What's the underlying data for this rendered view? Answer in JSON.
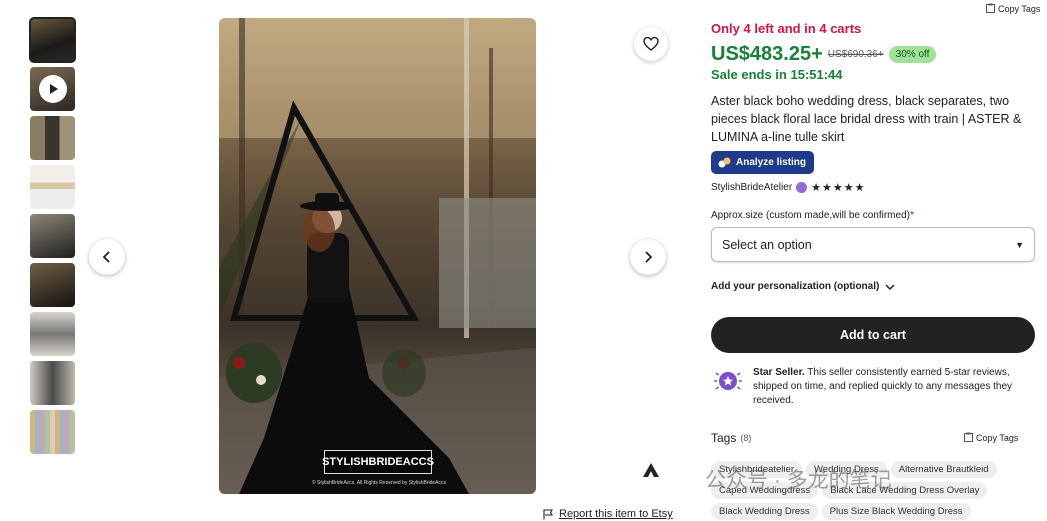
{
  "thumbnails": [
    {
      "kind": "image",
      "active": true
    },
    {
      "kind": "video",
      "active": false
    },
    {
      "kind": "image",
      "active": false
    },
    {
      "kind": "image",
      "active": false
    },
    {
      "kind": "image",
      "active": false
    },
    {
      "kind": "image",
      "active": false
    },
    {
      "kind": "image",
      "active": false
    },
    {
      "kind": "image",
      "active": false
    },
    {
      "kind": "image",
      "active": false
    }
  ],
  "hero": {
    "watermark": "STYLISHBRIDEACCS",
    "credit": "© StylishBrideAccs. All Rights Reserved by StylishBrideAccs",
    "prev_icon": "chevron-left-icon",
    "next_icon": "chevron-right-icon",
    "favorite_icon": "heart-icon"
  },
  "report_link": "Report this item to Etsy",
  "copy_tags_top": "Copy Tags",
  "stock_notice": "Only 4 left and in 4 carts",
  "price": "US$483.25+",
  "old_price": "US$690.36+",
  "discount": "30% off",
  "sale_ends": "Sale ends in 15:51:44",
  "title": "Aster black boho wedding dress, black separates, two pieces black floral lace bridal dress with train | ASTER & LUMINA a-line tulle skirt",
  "analyze_button": "Analyze listing",
  "seller": {
    "name": "StylishBrideAtelier",
    "stars": "★★★★★"
  },
  "size": {
    "label": "Approx.size (custom made,will be confirmed)",
    "required_mark": "*",
    "select_value": "Select an option"
  },
  "personalization": "Add your personalization (optional)",
  "add_to_cart": "Add to cart",
  "star_seller": {
    "title": "Star Seller.",
    "text": " This seller consistently earned 5-star reviews, shipped on time, and replied quickly to any messages they received."
  },
  "tags_section": {
    "title": "Tags",
    "count": "(8)",
    "copy": "Copy Tags"
  },
  "tags": [
    "Stylishbrideatelier",
    "Wedding Dress",
    "Alternative Brautkleid",
    "Caped Weddingdress",
    "Black Lace Wedding Dress Overlay",
    "Black Wedding Dress",
    "Plus Size Black Wedding Dress"
  ],
  "overlay_watermark": "公众号 · 多龙的笔记",
  "colors": {
    "accent_red": "#d1134f",
    "price_green": "#188038",
    "analyze_blue": "#1e3a8a",
    "star_purple": "#8e6bd6"
  }
}
